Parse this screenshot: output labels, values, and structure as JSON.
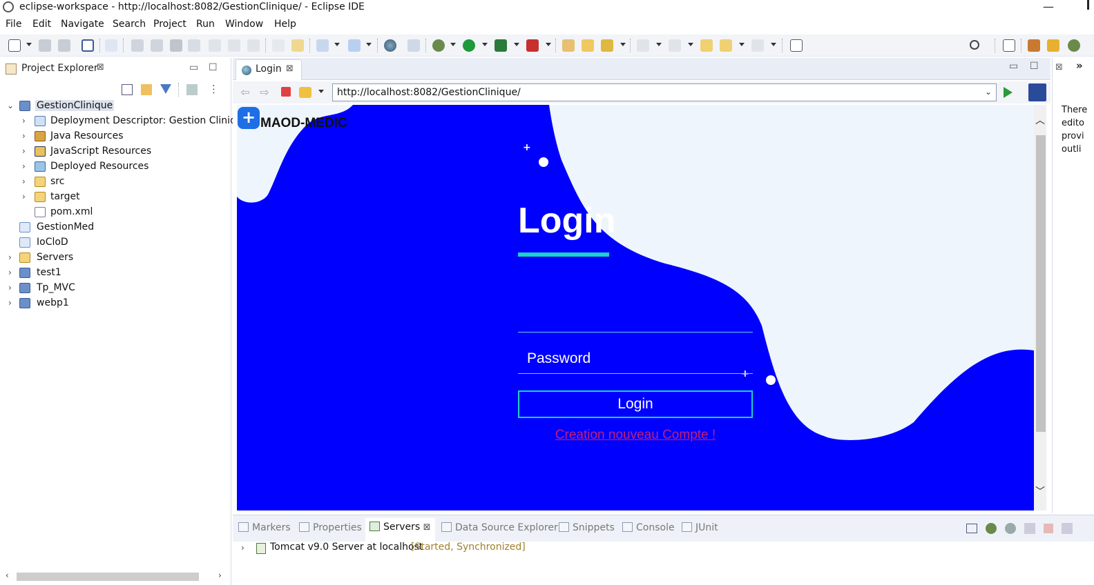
{
  "window": {
    "title": "eclipse-workspace - http://localhost:8082/GestionClinique/ - Eclipse IDE",
    "minimize_glyph": "—"
  },
  "menu": [
    "File",
    "Edit",
    "Navigate",
    "Search",
    "Project",
    "Run",
    "Window",
    "Help"
  ],
  "explorer": {
    "tab_label": "Project Explorer",
    "close_glyph": "⊠",
    "tree": [
      {
        "label": "GestionClinique",
        "icon": "project-icon",
        "twisty": "⌄",
        "level": 0
      },
      {
        "label": "Deployment Descriptor: Gestion Clinique",
        "icon": "deployment-descriptor-icon",
        "twisty": "›",
        "level": 1
      },
      {
        "label": "Java Resources",
        "icon": "java-resources-icon",
        "twisty": "›",
        "level": 1
      },
      {
        "label": "JavaScript Resources",
        "icon": "javascript-resources-icon",
        "twisty": "›",
        "level": 1
      },
      {
        "label": "Deployed Resources",
        "icon": "deployed-resources-icon",
        "twisty": "›",
        "level": 1
      },
      {
        "label": "src",
        "icon": "folder-icon",
        "twisty": "›",
        "level": 1
      },
      {
        "label": "target",
        "icon": "folder-icon",
        "twisty": "›",
        "level": 1
      },
      {
        "label": "pom.xml",
        "icon": "xml-file-icon",
        "twisty": "",
        "level": 1
      },
      {
        "label": "GestionMed",
        "icon": "closed-project-icon",
        "twisty": "",
        "level": 0
      },
      {
        "label": "IoCloD",
        "icon": "closed-project-icon",
        "twisty": "",
        "level": 0
      },
      {
        "label": "Servers",
        "icon": "folder-icon",
        "twisty": "›",
        "level": 0
      },
      {
        "label": "test1",
        "icon": "project-icon",
        "twisty": "›",
        "level": 0
      },
      {
        "label": "Tp_MVC",
        "icon": "project-icon",
        "twisty": "›",
        "level": 0
      },
      {
        "label": "webp1",
        "icon": "project-icon",
        "twisty": "›",
        "level": 0
      }
    ]
  },
  "editor": {
    "tab_label": "Login",
    "close_glyph": "⊠",
    "url": "http://localhost:8082/GestionClinique/"
  },
  "webpage": {
    "brand_badge": "+",
    "brand_name": "MAOD-MEDIC",
    "title": "Login",
    "password_placeholder": "Password",
    "login_button": "Login",
    "create_account_link": "Creation nouveau Compte !",
    "colors": {
      "background": "#0000ff",
      "wave": "#eef5fc",
      "accent": "#19d3c5",
      "link": "#c0207a"
    }
  },
  "outline": {
    "lines": [
      "There",
      "edito",
      "provi",
      "outli"
    ],
    "overflow_glyph": "»"
  },
  "bottom_panel": {
    "tabs": [
      "Markers",
      "Properties",
      "Servers",
      "Data Source Explorer",
      "Snippets",
      "Console",
      "JUnit"
    ],
    "active_tab": "Servers",
    "server_name": "Tomcat v9.0 Server at localhost",
    "server_state": "[Started, Synchronized]"
  }
}
